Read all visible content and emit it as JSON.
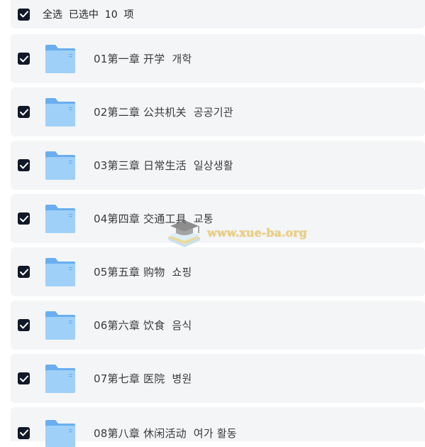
{
  "header": {
    "select_all_label": "全选  已选中  10  项",
    "checked": true
  },
  "folders": [
    {
      "label": "01第一章 开学  개학",
      "checked": true
    },
    {
      "label": "02第二章 公共机关  공공기관",
      "checked": true
    },
    {
      "label": "03第三章 日常生活  일상생활",
      "checked": true
    },
    {
      "label": "04第四章 交通工具  교통",
      "checked": true
    },
    {
      "label": "05第五章 购物  쇼핑",
      "checked": true
    },
    {
      "label": "06第六章 饮食  음식",
      "checked": true
    },
    {
      "label": "07第七章 医院  병원",
      "checked": true
    },
    {
      "label": "08第八章 休闲活动  여가 활동",
      "checked": true
    }
  ],
  "watermark": {
    "text": "www.xue-ba.org"
  },
  "colors": {
    "checkbox_bg": "#111827",
    "row_bg": "#f4f5f7",
    "folder_blue": "#8cc4f5"
  },
  "icons": {
    "checkbox": "checkmark-icon",
    "folder": "folder-icon",
    "watermark": "graduation-cap-icon"
  }
}
